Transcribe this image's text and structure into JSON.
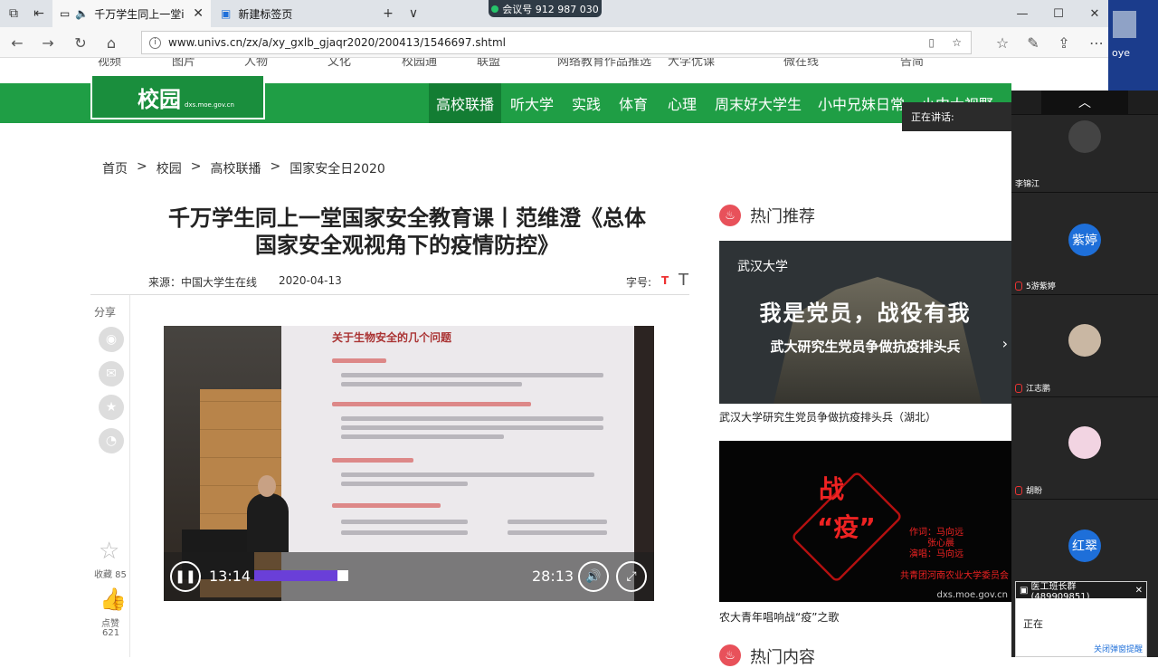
{
  "browser": {
    "tabs": [
      {
        "title": "千万学生同上一堂ⅰ",
        "close": "✕"
      },
      {
        "title": "新建标签页",
        "close": ""
      }
    ],
    "new_tab": "+",
    "tab_menu": "∨",
    "meeting_id": "会议号 912 987 030",
    "window_controls": {
      "minimize": "—",
      "maximize": "☐",
      "close": "✕"
    },
    "url": "www.univs.cn/zx/a/xy_gxlb_gjaqr2020/200413/1546697.shtml",
    "desktop_label": "oye"
  },
  "site": {
    "top_menu": [
      "视频",
      "图片",
      "人物",
      "文化",
      "校园通",
      "联盟",
      "网络教育作品推选",
      "大学优课",
      "微在线",
      "告简"
    ],
    "logo_main": "校园",
    "logo_sub": "dxs.moe.gov.cn",
    "nav": [
      "高校联播",
      "听大学",
      "实践",
      "体育",
      "心理",
      "周末好大学生",
      "小中兄妹日常",
      "小中大视野"
    ],
    "breadcrumb": [
      "首页",
      ">",
      "校园",
      ">",
      "高校联播",
      ">",
      "国家安全日2020"
    ]
  },
  "article": {
    "title_line1": "千万学生同上一堂国家安全教育课丨范维澄《总体",
    "title_line2": "国家安全观视角下的疫情防控》",
    "source": "来源：中国大学生在线",
    "date": "2020-04-13",
    "font_size_label": "字号:",
    "font_small": "T",
    "font_large": "T",
    "share_label": "分享",
    "favorite_label": "收藏 85",
    "like_label": "点赞",
    "like_count": "621"
  },
  "video": {
    "slide_title": "关于生物安全的几个问题",
    "current_time": "13:14",
    "duration": "28:13",
    "progress": 0.33
  },
  "hot": {
    "heading": "热门推荐",
    "items": [
      {
        "image_title": "我是党员，战役有我",
        "image_subtitle": "武大研究生党员争做抗疫排头兵",
        "image_logo": "武汉大学",
        "caption": "武汉大学研究生党员争做抗疫排头兵（湖北）"
      },
      {
        "image_word1": "战",
        "image_word2": "“疫”",
        "image_credit1": "作词：马向远",
        "image_credit2": "张心晨",
        "image_credit3": "演唱：马向远",
        "image_org": "共青团河南农业大学委员会",
        "image_src": "dxs.moe.gov.cn",
        "caption": "农大青年唱响战“疫”之歌"
      }
    ],
    "next_heading": "热门内容"
  },
  "meeting": {
    "collapse": "︿",
    "speaking": "正在讲话:",
    "participants": [
      {
        "name": "李锦江",
        "avatar_text": ""
      },
      {
        "name": "5游紫婷",
        "avatar_text": "紫婷",
        "color": "#1e6fd9"
      },
      {
        "name": "江志鹏",
        "avatar_text": ""
      },
      {
        "name": "胡盼",
        "avatar_text": ""
      },
      {
        "name": "",
        "avatar_text": "红翠",
        "color": "#1e6fd9"
      }
    ],
    "qq_title": "医工班长群(489909851)",
    "qq_body": "正在",
    "qq_link": "关闭弹窗提醒"
  }
}
